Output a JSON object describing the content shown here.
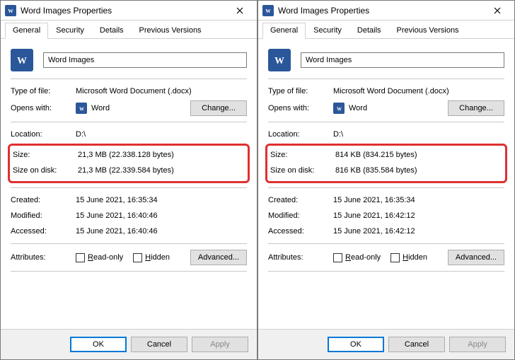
{
  "dialogs": [
    {
      "title": "Word Images Properties",
      "tabs": [
        "General",
        "Security",
        "Details",
        "Previous Versions"
      ],
      "active_tab": 0,
      "filename": "Word Images",
      "labels": {
        "type": "Type of file:",
        "opens": "Opens with:",
        "location": "Location:",
        "size": "Size:",
        "sizeod": "Size on disk:",
        "created": "Created:",
        "modified": "Modified:",
        "accessed": "Accessed:",
        "attributes": "Attributes:"
      },
      "type_of_file": "Microsoft Word Document (.docx)",
      "opens_with": "Word",
      "change_btn": "Change...",
      "location": "D:\\",
      "size": "21,3 MB (22.338.128 bytes)",
      "size_on_disk": "21,3 MB (22.339.584 bytes)",
      "created": "15 June 2021, 16:35:34",
      "modified": "15 June 2021, 16:40:46",
      "accessed": "15 June 2021, 16:40:46",
      "readonly_label_pre": "R",
      "readonly_label_post": "ead-only",
      "hidden_label_pre": "H",
      "hidden_label_post": "idden",
      "advanced_btn": "Advanced...",
      "ok": "OK",
      "cancel": "Cancel",
      "apply": "Apply"
    },
    {
      "title": "Word Images Properties",
      "tabs": [
        "General",
        "Security",
        "Details",
        "Previous Versions"
      ],
      "active_tab": 0,
      "filename": "Word Images",
      "labels": {
        "type": "Type of file:",
        "opens": "Opens with:",
        "location": "Location:",
        "size": "Size:",
        "sizeod": "Size on disk:",
        "created": "Created:",
        "modified": "Modified:",
        "accessed": "Accessed:",
        "attributes": "Attributes:"
      },
      "type_of_file": "Microsoft Word Document (.docx)",
      "opens_with": "Word",
      "change_btn": "Change...",
      "location": "D:\\",
      "size": "814 KB (834.215 bytes)",
      "size_on_disk": "816 KB (835.584 bytes)",
      "created": "15 June 2021, 16:35:34",
      "modified": "15 June 2021, 16:42:12",
      "accessed": "15 June 2021, 16:42:12",
      "readonly_label_pre": "R",
      "readonly_label_post": "ead-only",
      "hidden_label_pre": "H",
      "hidden_label_post": "idden",
      "advanced_btn": "Advanced...",
      "ok": "OK",
      "cancel": "Cancel",
      "apply": "Apply"
    }
  ]
}
